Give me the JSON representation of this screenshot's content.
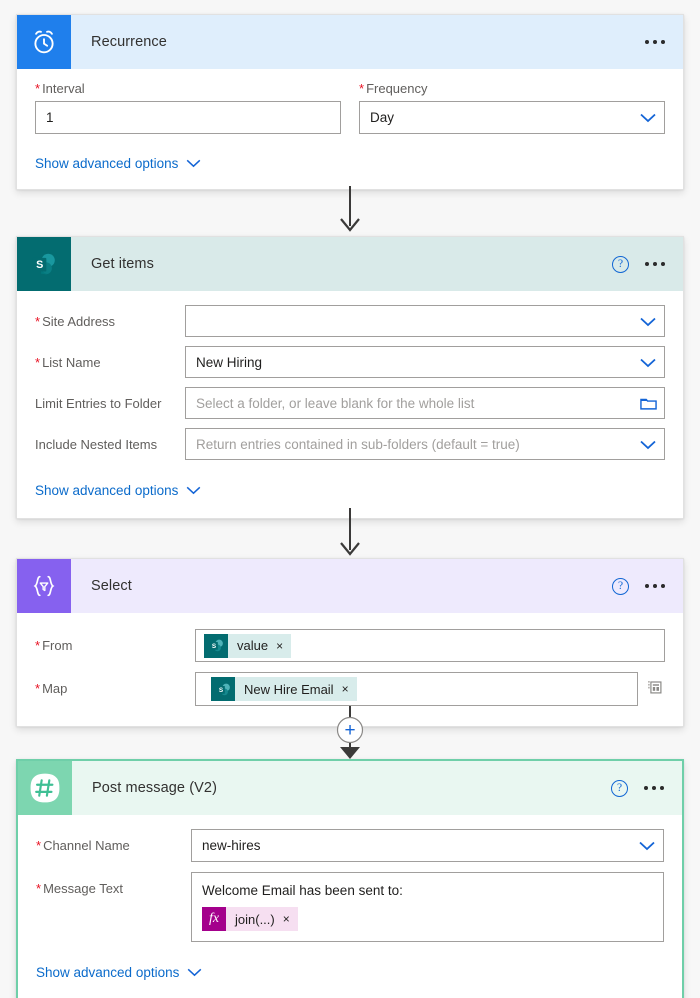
{
  "flow": {
    "cards": [
      {
        "id": "recurrence",
        "title": "Recurrence",
        "icon": "alarm-clock-icon",
        "icon_bg": "#1f7fec",
        "header_bg": "#dfeefc",
        "has_help": false,
        "advanced_label": "Show advanced options",
        "fields": [
          {
            "label": "Interval",
            "required": true,
            "value": "1",
            "placeholder": "",
            "control": "text"
          },
          {
            "label": "Frequency",
            "required": true,
            "value": "Day",
            "placeholder": "",
            "control": "dropdown"
          }
        ]
      },
      {
        "id": "get-items",
        "title": "Get items",
        "icon": "sharepoint-icon",
        "icon_bg": "#036c70",
        "header_bg": "#d9eae9",
        "has_help": true,
        "advanced_label": "Show advanced options",
        "fields": [
          {
            "label": "Site Address",
            "required": true,
            "value": "",
            "placeholder": "",
            "control": "dropdown"
          },
          {
            "label": "List Name",
            "required": true,
            "value": "New Hiring",
            "placeholder": "",
            "control": "dropdown"
          },
          {
            "label": "Limit Entries to Folder",
            "required": false,
            "value": "",
            "placeholder": "Select a folder, or leave blank for the whole list",
            "control": "folder"
          },
          {
            "label": "Include Nested Items",
            "required": false,
            "value": "",
            "placeholder": "Return entries contained in sub-folders (default = true)",
            "control": "dropdown"
          }
        ]
      },
      {
        "id": "select",
        "title": "Select",
        "icon": "select-braces-funnel-icon",
        "icon_bg": "#8661ef",
        "header_bg": "#eeeafd",
        "has_help": true,
        "advanced_label": "",
        "fields": [
          {
            "label": "From",
            "required": true,
            "control": "token",
            "token": {
              "text": "value",
              "icon": "sharepoint-icon",
              "remove": "×"
            }
          },
          {
            "label": "Map",
            "required": true,
            "control": "token-map",
            "token": {
              "text": "New Hire Email",
              "icon": "sharepoint-icon",
              "remove": "×"
            },
            "side_icon": "switch-to-text-mode-icon"
          }
        ]
      },
      {
        "id": "post-message-v2",
        "title": "Post message (V2)",
        "icon": "slack-hash-icon",
        "icon_bg": "#7dd6b0",
        "header_bg": "#e9f7f1",
        "has_help": true,
        "selected": true,
        "advanced_label": "Show advanced options",
        "fields": [
          {
            "label": "Channel Name",
            "required": true,
            "value": "new-hires",
            "placeholder": "",
            "control": "dropdown"
          },
          {
            "label": "Message Text",
            "required": true,
            "control": "message",
            "text_line": "Welcome Email has been sent to:",
            "token": {
              "text": "join(...)",
              "icon": "fx-icon",
              "remove": "×"
            }
          }
        ]
      }
    ],
    "connectors": [
      {
        "type": "arrow",
        "after": "recurrence"
      },
      {
        "type": "arrow",
        "after": "get-items"
      },
      {
        "type": "plus-arrow",
        "after": "select",
        "plus_label": "+"
      }
    ]
  },
  "colors": {
    "accent_blue": "#0b6bcb",
    "required_red": "#e81123",
    "sharepoint_teal": "#036c70",
    "select_purple": "#8661ef",
    "slack_green": "#7dd6b0",
    "fx_magenta": "#a4008c",
    "canvas": "#f7f7f7"
  }
}
